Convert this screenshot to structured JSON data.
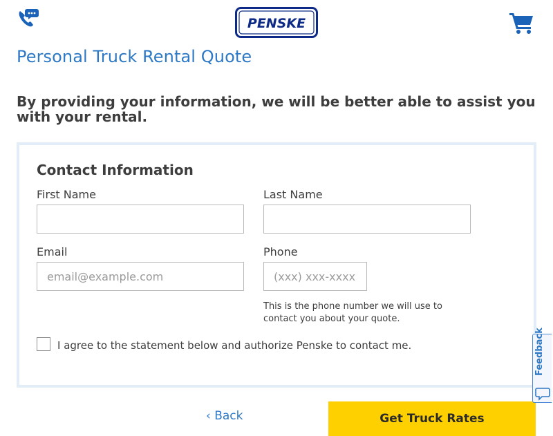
{
  "header": {
    "logo_text": "PENSKE",
    "phone_icon": "phone-chat-icon",
    "cart_icon": "shopping-cart-icon"
  },
  "page": {
    "title": "Personal Truck Rental Quote",
    "intro": "By providing your information, we will be better able to assist you with your rental."
  },
  "form": {
    "section_title": "Contact Information",
    "first_name": {
      "label": "First Name",
      "value": "",
      "placeholder": ""
    },
    "last_name": {
      "label": "Last Name",
      "value": "",
      "placeholder": ""
    },
    "email": {
      "label": "Email",
      "value": "",
      "placeholder": "email@example.com"
    },
    "phone": {
      "label": "Phone",
      "value": "",
      "placeholder": "(xxx) xxx-xxxx",
      "hint": "This is the phone number we will use to contact you about your quote."
    },
    "consent": {
      "label": "I agree to the statement below and authorize Penske to contact me.",
      "checked": false
    }
  },
  "actions": {
    "back_label": "‹ Back",
    "submit_label": "Get Truck Rates"
  },
  "feedback": {
    "label": "Feedback",
    "icon": "speech-bubble-icon"
  },
  "colors": {
    "accent_blue": "#2e79c5",
    "logo_navy": "#0d2a86",
    "cta_yellow": "#ffd000",
    "card_border": "#e3edf8"
  }
}
